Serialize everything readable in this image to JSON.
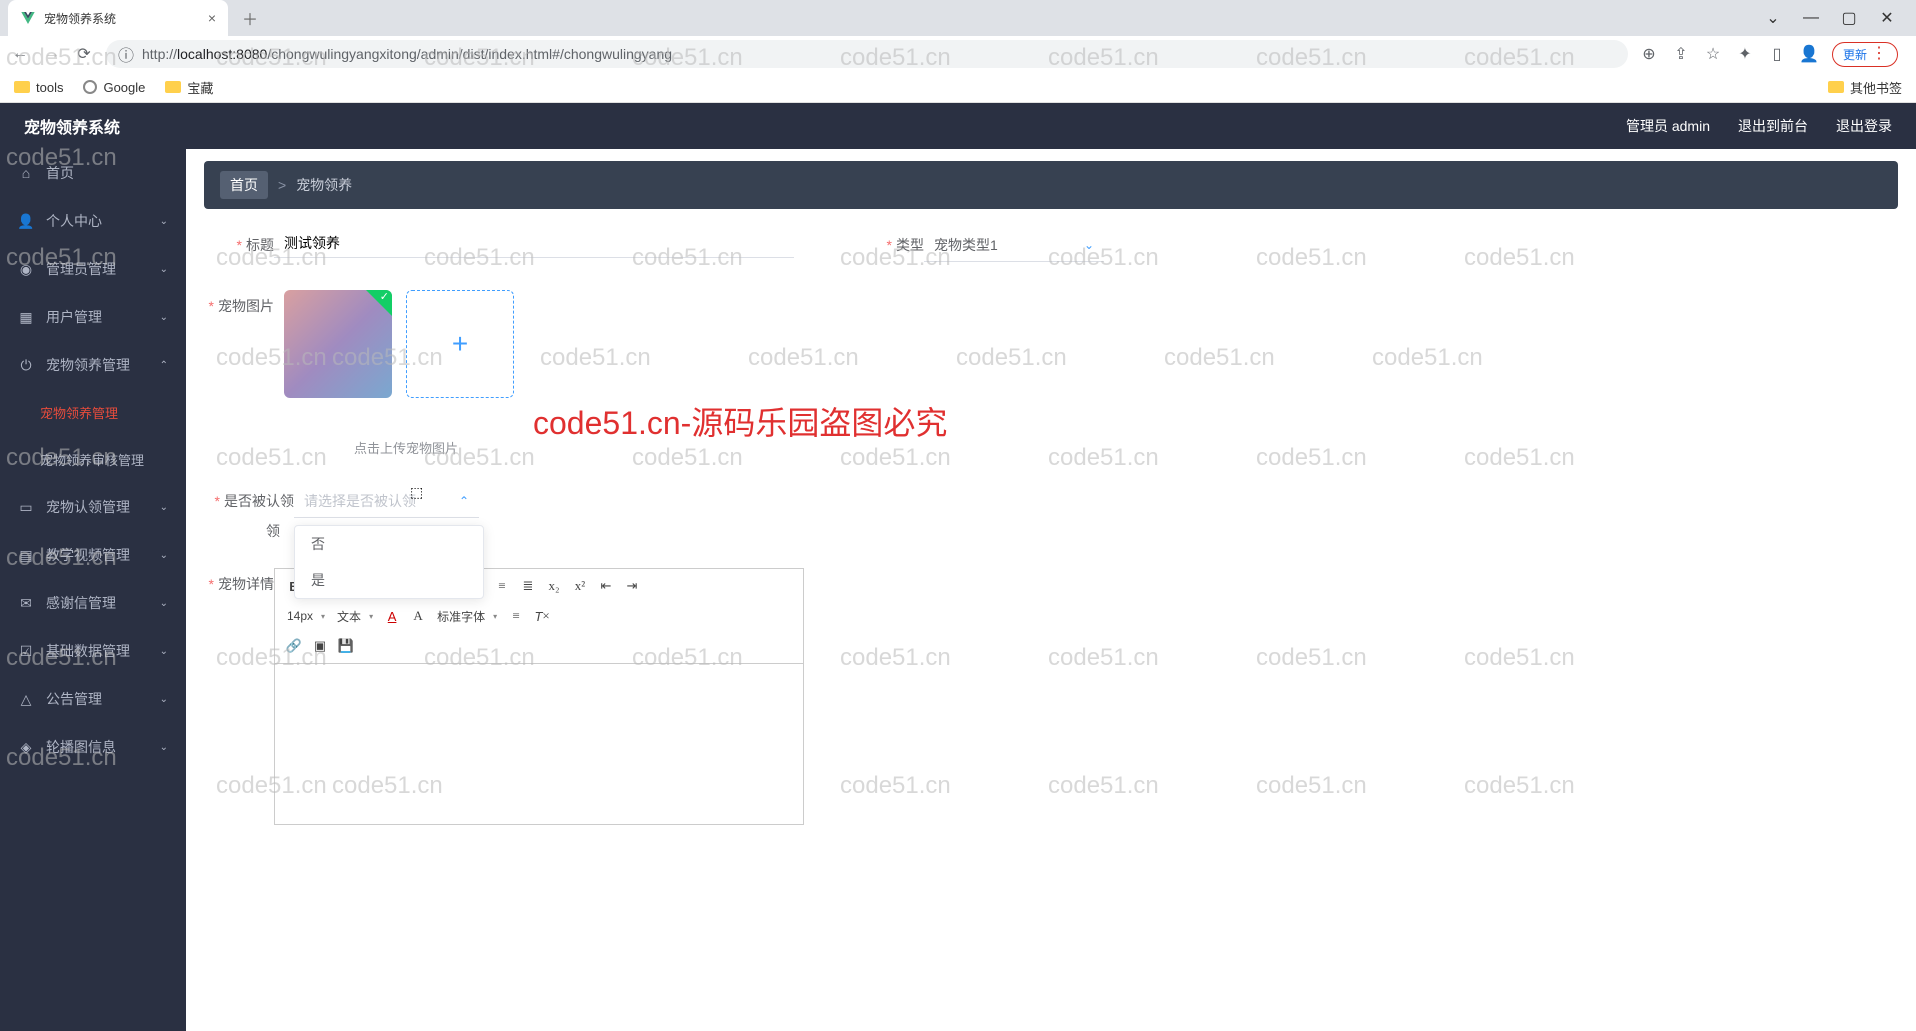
{
  "browser": {
    "tab_title": "宠物领养系统",
    "url_host": "localhost:8080",
    "url_path": "/chongwulingyangxitong/admin/dist/index.html#/chongwulingyang",
    "update_label": "更新",
    "bookmarks": {
      "tools": "tools",
      "google": "Google",
      "treasure": "宝藏",
      "other": "其他书签"
    }
  },
  "header": {
    "app_title": "宠物领养系统",
    "user_label": "管理员 admin",
    "to_front": "退出到前台",
    "logout": "退出登录"
  },
  "sidebar": {
    "home": "首页",
    "personal": "个人中心",
    "admin_mgmt": "管理员管理",
    "user_mgmt": "用户管理",
    "adopt_mgmt": "宠物领养管理",
    "adopt_mgmt_sub": "宠物领养管理",
    "adopt_audit_sub": "宠物领养审核管理",
    "claim_mgmt": "宠物认领管理",
    "video_mgmt": "教学视频管理",
    "thank_mgmt": "感谢信管理",
    "base_mgmt": "基础数据管理",
    "notice_mgmt": "公告管理",
    "carousel_mgmt": "轮播图信息"
  },
  "breadcrumb": {
    "home": "首页",
    "sep": ">",
    "current": "宠物领养"
  },
  "form": {
    "title_label": "标题",
    "title_value": "测试领养",
    "type_label": "类型",
    "type_value": "宠物类型1",
    "photo_label": "宠物图片",
    "upload_hint": "点击上传宠物图片",
    "claimed_label": "是否被认领",
    "claimed_placeholder": "请选择是否被认领",
    "claimed_cut_label": "领",
    "claimed_options": {
      "no": "否",
      "yes": "是"
    },
    "detail_label": "宠物详情"
  },
  "editor": {
    "font_size": "14px",
    "text_style": "文本",
    "font_family": "标准字体"
  },
  "watermark": {
    "text": "code51.cn",
    "red": "code51.cn-源码乐园盗图必究"
  }
}
